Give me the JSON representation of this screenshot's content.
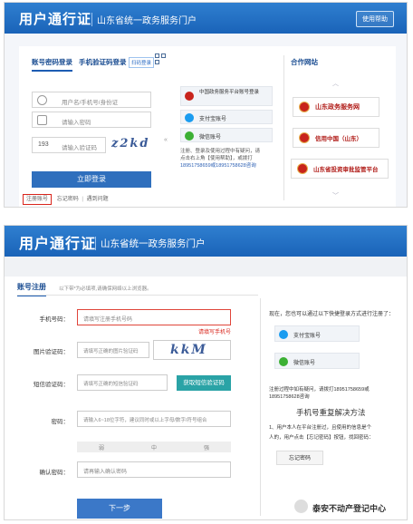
{
  "shot1": {
    "header": {
      "logo": "用户通行证",
      "subtitle": "山东省统一政务服务门户",
      "help_label": "使用帮助"
    },
    "tabs": [
      "账号密码登录",
      "手机验证码登录"
    ],
    "qr_tag": "扫码登录",
    "login_form": {
      "username_placeholder": "用户名/手机号/身份证",
      "password_placeholder": "请输入密码",
      "captcha_placeholder": "请输入验证码",
      "captcha_prefix": "193",
      "captcha_text": "z2kd",
      "submit_label": "立即登录"
    },
    "links": {
      "register": "注册账号",
      "forgot": "忘记密码",
      "faq": "遇到问题"
    },
    "third_party": [
      {
        "label": "中国政务服务平台账号登录",
        "icon": "gov-emblem-icon",
        "color": "#c8241c"
      },
      {
        "label": "支付宝账号",
        "icon": "alipay-icon",
        "color": "#1a9cf0"
      },
      {
        "label": "微信账号",
        "icon": "wechat-icon",
        "color": "#3cb034"
      }
    ],
    "note": {
      "line1": "注册、登录及使用过程中有疑问，请",
      "line2": "点击右上角【使用帮助】，或拨打",
      "line3": "18951758659或18951758628咨询"
    },
    "partners": {
      "title": "合作网站",
      "items": [
        "山东政务服务网",
        "信用中国（山东）",
        "山东省投资审批监管平台"
      ]
    }
  },
  "shot2": {
    "header": {
      "logo": "用户通行证",
      "subtitle": "山东省统一政务服务门户"
    },
    "title": "账号注册",
    "hint": "以下带*为必填项,请确保网络以上浏览器。",
    "fields": {
      "phone_label": "手机号码：",
      "phone_placeholder": "请填写注册手机号码",
      "phone_error": "请填写手机号",
      "image_code_label": "图片验证码：",
      "image_code_placeholder": "请填写正确的图片验证码",
      "captcha_text": "kkM",
      "sms_label": "短信验证码：",
      "sms_placeholder": "请填写正确的短信验证码",
      "sms_button": "获取短信验证码",
      "password_label": "密码：",
      "password_placeholder": "请输入6~18位字符，建议同时或以上字母/数字/符号组合",
      "strength": [
        "弱",
        "中",
        "强"
      ],
      "confirm_label": "确认密码：",
      "confirm_placeholder": "请再输入确认密码",
      "next_button": "下一步"
    },
    "right": {
      "intro": "现在，您也可以通过以下快捷登录方式进行注册了：",
      "alipay": "支付宝账号",
      "wechat": "微信账号",
      "note1": "注册过程中如有疑问，请拨打18951758659或",
      "note2": "18951758628咨询",
      "solution_title": "手机号重复解决方法",
      "step1": "1、用户本人在平台注册过，且使用的信息是个",
      "step2": "人的，用户点击【忘记密码】按钮，找回密码：",
      "forgot_button": "忘记密码"
    },
    "watermark": "泰安不动产登记中心"
  }
}
